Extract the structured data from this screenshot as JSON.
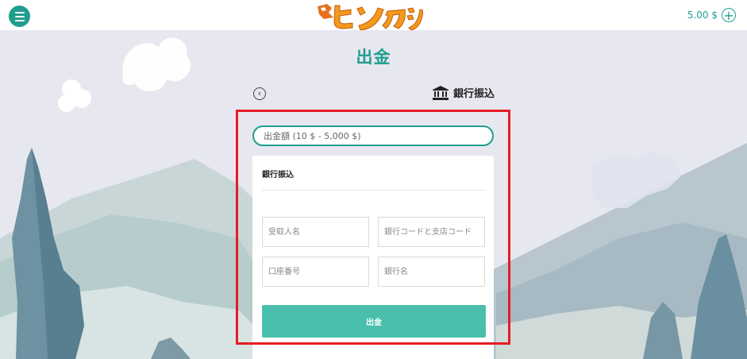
{
  "header": {
    "balance": "5.00 $"
  },
  "page": {
    "title": "出金"
  },
  "method": {
    "label": "銀行振込"
  },
  "form": {
    "amount_placeholder": "出金額 (10 $ - 5,000 $)",
    "section_title": "銀行振込",
    "fields": {
      "recipient_placeholder": "受取人名",
      "bank_code_placeholder": "銀行コードと支店コード",
      "account_placeholder": "口座番号",
      "bank_name_placeholder": "銀行名"
    },
    "submit_label": "出金"
  },
  "colors": {
    "accent": "#1f9e8f",
    "button": "#4abfab",
    "highlight": "#e51c23"
  }
}
